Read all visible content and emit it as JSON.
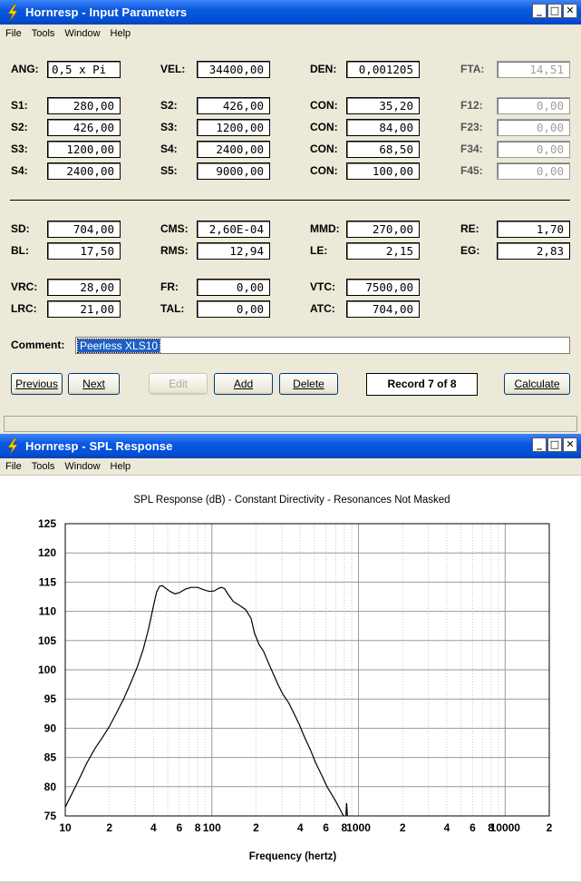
{
  "input_window": {
    "title": "Hornresp - Input Parameters",
    "menu": [
      "File",
      "Tools",
      "Window",
      "Help"
    ],
    "params": {
      "ang": {
        "label": "ANG:",
        "value": "0,5 x Pi"
      },
      "vel": {
        "label": "VEL:",
        "value": "34400,00"
      },
      "den": {
        "label": "DEN:",
        "value": "0,001205"
      },
      "fta": {
        "label": "FTA:",
        "value": "14,51"
      },
      "s1": {
        "label": "S1:",
        "value": "280,00"
      },
      "s2a": {
        "label": "S2:",
        "value": "426,00"
      },
      "con1": {
        "label": "CON:",
        "value": "35,20"
      },
      "f12": {
        "label": "F12:",
        "value": "0,00"
      },
      "s2b": {
        "label": "S2:",
        "value": "426,00"
      },
      "s3a": {
        "label": "S3:",
        "value": "1200,00"
      },
      "con2": {
        "label": "CON:",
        "value": "84,00"
      },
      "f23": {
        "label": "F23:",
        "value": "0,00"
      },
      "s3b": {
        "label": "S3:",
        "value": "1200,00"
      },
      "s4a": {
        "label": "S4:",
        "value": "2400,00"
      },
      "con3": {
        "label": "CON:",
        "value": "68,50"
      },
      "f34": {
        "label": "F34:",
        "value": "0,00"
      },
      "s4b": {
        "label": "S4:",
        "value": "2400,00"
      },
      "s5": {
        "label": "S5:",
        "value": "9000,00"
      },
      "con4": {
        "label": "CON:",
        "value": "100,00"
      },
      "f45": {
        "label": "F45:",
        "value": "0,00"
      },
      "sd": {
        "label": "SD:",
        "value": "704,00"
      },
      "cms": {
        "label": "CMS:",
        "value": "2,60E-04"
      },
      "mmd": {
        "label": "MMD:",
        "value": "270,00"
      },
      "re": {
        "label": "RE:",
        "value": "1,70"
      },
      "bl": {
        "label": "BL:",
        "value": "17,50"
      },
      "rms": {
        "label": "RMS:",
        "value": "12,94"
      },
      "le": {
        "label": "LE:",
        "value": "2,15"
      },
      "eg": {
        "label": "EG:",
        "value": "2,83"
      },
      "vrc": {
        "label": "VRC:",
        "value": "28,00"
      },
      "fr": {
        "label": "FR:",
        "value": "0,00"
      },
      "vtc": {
        "label": "VTC:",
        "value": "7500,00"
      },
      "lrc": {
        "label": "LRC:",
        "value": "21,00"
      },
      "tal": {
        "label": "TAL:",
        "value": "0,00"
      },
      "atc": {
        "label": "ATC:",
        "value": "704,00"
      }
    },
    "comment_label": "Comment:",
    "comment_value": "Peerless XLS10",
    "buttons": {
      "previous": "Previous",
      "next": "Next",
      "edit": "Edit",
      "add": "Add",
      "delete": "Delete",
      "calculate": "Calculate"
    },
    "record": "Record 7 of 8"
  },
  "spl_window": {
    "title": "Hornresp - SPL Response",
    "menu": [
      "File",
      "Tools",
      "Window",
      "Help"
    ]
  },
  "chart_data": {
    "type": "line",
    "title": "SPL Response (dB) - Constant Directivity - Resonances Not Masked",
    "xlabel": "Frequency (hertz)",
    "ylabel": "",
    "x_scale": "log",
    "xlim": [
      10,
      20000
    ],
    "ylim": [
      75,
      125
    ],
    "yticks": [
      125,
      120,
      115,
      110,
      105,
      100,
      95,
      90,
      85,
      80,
      75
    ],
    "xtick_labels": [
      {
        "x": 10,
        "label": "10"
      },
      {
        "x": 20,
        "label": "2"
      },
      {
        "x": 40,
        "label": "4"
      },
      {
        "x": 60,
        "label": "6"
      },
      {
        "x": 80,
        "label": "8"
      },
      {
        "x": 100,
        "label": "100"
      },
      {
        "x": 200,
        "label": "2"
      },
      {
        "x": 400,
        "label": "4"
      },
      {
        "x": 600,
        "label": "6"
      },
      {
        "x": 800,
        "label": "8"
      },
      {
        "x": 1000,
        "label": "1000"
      },
      {
        "x": 2000,
        "label": "2"
      },
      {
        "x": 4000,
        "label": "4"
      },
      {
        "x": 6000,
        "label": "6"
      },
      {
        "x": 8000,
        "label": "8"
      },
      {
        "x": 10000,
        "label": "10000"
      },
      {
        "x": 20000,
        "label": "2"
      }
    ],
    "grid": true,
    "series": [
      {
        "color": "#000000",
        "points": [
          [
            10,
            76.5
          ],
          [
            12,
            80.5
          ],
          [
            14,
            84
          ],
          [
            16,
            86.6
          ],
          [
            18,
            88.5
          ],
          [
            20,
            90.3
          ],
          [
            22,
            92.3
          ],
          [
            25,
            95
          ],
          [
            28,
            97.8
          ],
          [
            31,
            100.5
          ],
          [
            34,
            103.5
          ],
          [
            37,
            107
          ],
          [
            40,
            111
          ],
          [
            42,
            113.3
          ],
          [
            44,
            114.3
          ],
          [
            46,
            114.4
          ],
          [
            48,
            114
          ],
          [
            52,
            113.4
          ],
          [
            56,
            113
          ],
          [
            60,
            113.2
          ],
          [
            66,
            113.8
          ],
          [
            72,
            114.1
          ],
          [
            80,
            114.1
          ],
          [
            88,
            113.7
          ],
          [
            96,
            113.4
          ],
          [
            104,
            113.5
          ],
          [
            110,
            113.9
          ],
          [
            116,
            114.1
          ],
          [
            122,
            113.9
          ],
          [
            130,
            112.8
          ],
          [
            140,
            111.7
          ],
          [
            155,
            111
          ],
          [
            170,
            110.3
          ],
          [
            185,
            108.8
          ],
          [
            195,
            106.3
          ],
          [
            210,
            104.3
          ],
          [
            225,
            103.2
          ],
          [
            240,
            101.5
          ],
          [
            260,
            99.5
          ],
          [
            285,
            97.3
          ],
          [
            305,
            95.8
          ],
          [
            335,
            94.3
          ],
          [
            365,
            92.4
          ],
          [
            395,
            90.6
          ],
          [
            430,
            88.4
          ],
          [
            470,
            86.3
          ],
          [
            510,
            84.1
          ],
          [
            560,
            82
          ],
          [
            610,
            80
          ],
          [
            660,
            78.6
          ],
          [
            710,
            77.2
          ],
          [
            760,
            75.8
          ],
          [
            790,
            75
          ]
        ]
      }
    ],
    "annotation_spike": [
      [
        820,
        75
      ],
      [
        830,
        77.2
      ],
      [
        840,
        75
      ]
    ]
  }
}
